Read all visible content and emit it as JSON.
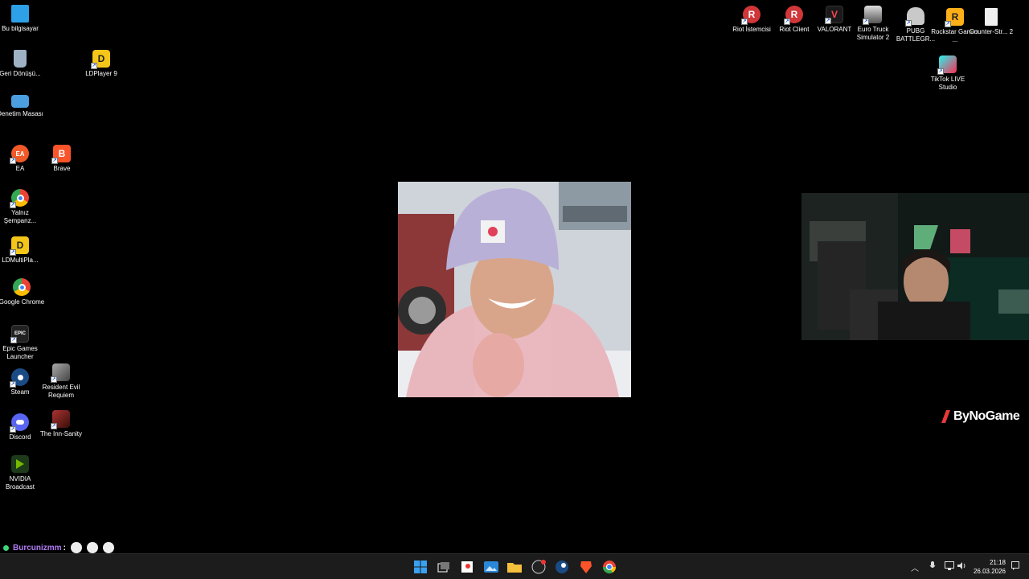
{
  "desktop": {
    "left_icons": [
      {
        "name": "this-pc",
        "label": "Bu bilgisayar",
        "color": "#2ea0e8",
        "glyph": ""
      },
      {
        "name": "recycle-bin",
        "label": "Geri Dönüşü...",
        "color": "#9fb1c4",
        "glyph": ""
      },
      {
        "name": "ldplayer9",
        "label": "LDPlayer 9",
        "color": "#f4c619",
        "glyph": "D"
      },
      {
        "name": "control-panel",
        "label": "Denetim Masası",
        "color": "#4b9ee0",
        "glyph": ""
      },
      {
        "name": "ea",
        "label": "EA",
        "color": "#f05a28",
        "glyph": "EA"
      },
      {
        "name": "brave",
        "label": "Brave",
        "color": "#fb542b",
        "glyph": "B"
      },
      {
        "name": "yalniz-sempanzi",
        "label": "Yalnız Şempanz...",
        "color": "#4285f4",
        "glyph": ""
      },
      {
        "name": "ldmultiplayer",
        "label": "LDMultiPla...",
        "color": "#f4c619",
        "glyph": "D"
      },
      {
        "name": "google-chrome",
        "label": "Google Chrome",
        "color": "#4285f4",
        "glyph": ""
      },
      {
        "name": "epic-games",
        "label": "Epic Games Launcher",
        "color": "#222222",
        "glyph": "EPIC"
      },
      {
        "name": "steam",
        "label": "Steam",
        "color": "#1b4b85",
        "glyph": ""
      },
      {
        "name": "resident-evil",
        "label": "Resident Evil Requiem",
        "color": "#7a7a7a",
        "glyph": ""
      },
      {
        "name": "discord",
        "label": "Discord",
        "color": "#5865f2",
        "glyph": ""
      },
      {
        "name": "inn-sanity",
        "label": "The Inn-Sanity",
        "color": "#7a2a1e",
        "glyph": ""
      },
      {
        "name": "nvidia-broadcast",
        "label": "NVIDIA Broadcast",
        "color": "#1d3a1a",
        "glyph": ""
      }
    ],
    "right_icons": [
      {
        "name": "riot-istemcisi",
        "label": "Riot İstemcisi",
        "color": "#d13639",
        "glyph": "R"
      },
      {
        "name": "riot-client",
        "label": "Riot Client",
        "color": "#d13639",
        "glyph": "R"
      },
      {
        "name": "valorant",
        "label": "VALORANT",
        "color": "#1a1a1a",
        "glyph": "V"
      },
      {
        "name": "euro-truck",
        "label": "Euro Truck Simulator 2",
        "color": "#4d4d4d",
        "glyph": ""
      },
      {
        "name": "pubg",
        "label": "PUBG BATTLEGR...",
        "color": "#c9c9c9",
        "glyph": ""
      },
      {
        "name": "rockstar",
        "label": "Rockstar Games ...",
        "color": "#fcaf17",
        "glyph": "R"
      },
      {
        "name": "counter-strike",
        "label": "Counter-Str... 2",
        "color": "#f1f1f1",
        "glyph": ""
      },
      {
        "name": "tiktok-live",
        "label": "TikTok LIVE Studio",
        "color": "#fe2c55",
        "glyph": ""
      }
    ]
  },
  "overlay": {
    "brand": "ByNoGame",
    "chat_user": "Burcunizmm",
    "chat_colon": ":"
  },
  "taskbar": {
    "apps": [
      "start-icon",
      "task-view-icon",
      "snipping-icon",
      "photos-icon",
      "file-explorer-icon",
      "obs-icon",
      "steam-icon",
      "brave-icon",
      "chrome-icon"
    ],
    "time": "21:18",
    "date": "26.03.2026"
  }
}
